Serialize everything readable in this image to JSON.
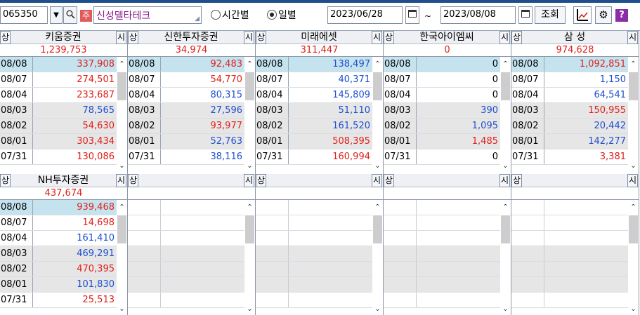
{
  "toolbar": {
    "code": "065350",
    "ju_badge": "주",
    "stock_name": "신성델타테크",
    "radio_time_label": "시간별",
    "radio_day_label": "일별",
    "date_from": "2023/06/28",
    "date_to": "2023/08/08",
    "tilde": "~",
    "query_label": "조회",
    "help_label": "?"
  },
  "panel_labels": {
    "up": "상",
    "down": "시"
  },
  "panels": [
    {
      "broker": "키움증권",
      "total": "1,239,753",
      "rows": [
        {
          "date": "08/08",
          "value": "337,908",
          "color": "red"
        },
        {
          "date": "08/07",
          "value": "274,501",
          "color": "red"
        },
        {
          "date": "08/04",
          "value": "233,687",
          "color": "red"
        },
        {
          "date": "08/03",
          "value": "78,565",
          "color": "blue"
        },
        {
          "date": "08/02",
          "value": "54,630",
          "color": "red"
        },
        {
          "date": "08/01",
          "value": "303,434",
          "color": "red"
        },
        {
          "date": "07/31",
          "value": "130,086",
          "color": "red"
        }
      ]
    },
    {
      "broker": "신한투자증권",
      "total": "34,974",
      "rows": [
        {
          "date": "08/08",
          "value": "92,483",
          "color": "red"
        },
        {
          "date": "08/07",
          "value": "54,770",
          "color": "red"
        },
        {
          "date": "08/04",
          "value": "80,315",
          "color": "blue"
        },
        {
          "date": "08/03",
          "value": "27,596",
          "color": "blue"
        },
        {
          "date": "08/02",
          "value": "93,977",
          "color": "red"
        },
        {
          "date": "08/01",
          "value": "52,763",
          "color": "blue"
        },
        {
          "date": "07/31",
          "value": "38,116",
          "color": "blue"
        }
      ]
    },
    {
      "broker": "미래에셋",
      "total": "311,447",
      "rows": [
        {
          "date": "08/08",
          "value": "138,497",
          "color": "blue"
        },
        {
          "date": "08/07",
          "value": "40,371",
          "color": "blue"
        },
        {
          "date": "08/04",
          "value": "145,809",
          "color": "blue"
        },
        {
          "date": "08/03",
          "value": "51,110",
          "color": "blue"
        },
        {
          "date": "08/02",
          "value": "161,520",
          "color": "blue"
        },
        {
          "date": "08/01",
          "value": "508,395",
          "color": "red"
        },
        {
          "date": "07/31",
          "value": "160,994",
          "color": "red"
        }
      ]
    },
    {
      "broker": "한국아이엠씨",
      "total": "0",
      "rows": [
        {
          "date": "08/08",
          "value": "0",
          "color": "black"
        },
        {
          "date": "08/07",
          "value": "0",
          "color": "black"
        },
        {
          "date": "08/04",
          "value": "0",
          "color": "black"
        },
        {
          "date": "08/03",
          "value": "390",
          "color": "blue"
        },
        {
          "date": "08/02",
          "value": "1,095",
          "color": "blue"
        },
        {
          "date": "08/01",
          "value": "1,485",
          "color": "red"
        },
        {
          "date": "07/31",
          "value": "0",
          "color": "black"
        }
      ]
    },
    {
      "broker": "삼 성",
      "total": "974,628",
      "rows": [
        {
          "date": "08/08",
          "value": "1,092,851",
          "color": "red"
        },
        {
          "date": "08/07",
          "value": "1,150",
          "color": "blue"
        },
        {
          "date": "08/04",
          "value": "64,541",
          "color": "blue"
        },
        {
          "date": "08/03",
          "value": "150,955",
          "color": "red"
        },
        {
          "date": "08/02",
          "value": "20,442",
          "color": "blue"
        },
        {
          "date": "08/01",
          "value": "142,277",
          "color": "blue"
        },
        {
          "date": "07/31",
          "value": "3,381",
          "color": "red"
        }
      ]
    },
    {
      "broker": "NH투자증권",
      "total": "437,674",
      "rows": [
        {
          "date": "08/08",
          "value": "939,468",
          "color": "red"
        },
        {
          "date": "08/07",
          "value": "14,698",
          "color": "red"
        },
        {
          "date": "08/04",
          "value": "161,410",
          "color": "blue"
        },
        {
          "date": "08/03",
          "value": "469,291",
          "color": "blue"
        },
        {
          "date": "08/02",
          "value": "470,395",
          "color": "red"
        },
        {
          "date": "08/01",
          "value": "101,830",
          "color": "blue"
        },
        {
          "date": "07/31",
          "value": "25,513",
          "color": "red"
        }
      ]
    },
    {
      "broker": "",
      "total": "",
      "rows": []
    },
    {
      "broker": "",
      "total": "",
      "rows": []
    },
    {
      "broker": "",
      "total": "",
      "rows": []
    },
    {
      "broker": "",
      "total": "",
      "rows": []
    }
  ],
  "colors": {
    "up": "#e0201a",
    "down": "#1f4fd0",
    "selected_row": "#c5e3ef",
    "alt_row": "#e6e6e6"
  }
}
